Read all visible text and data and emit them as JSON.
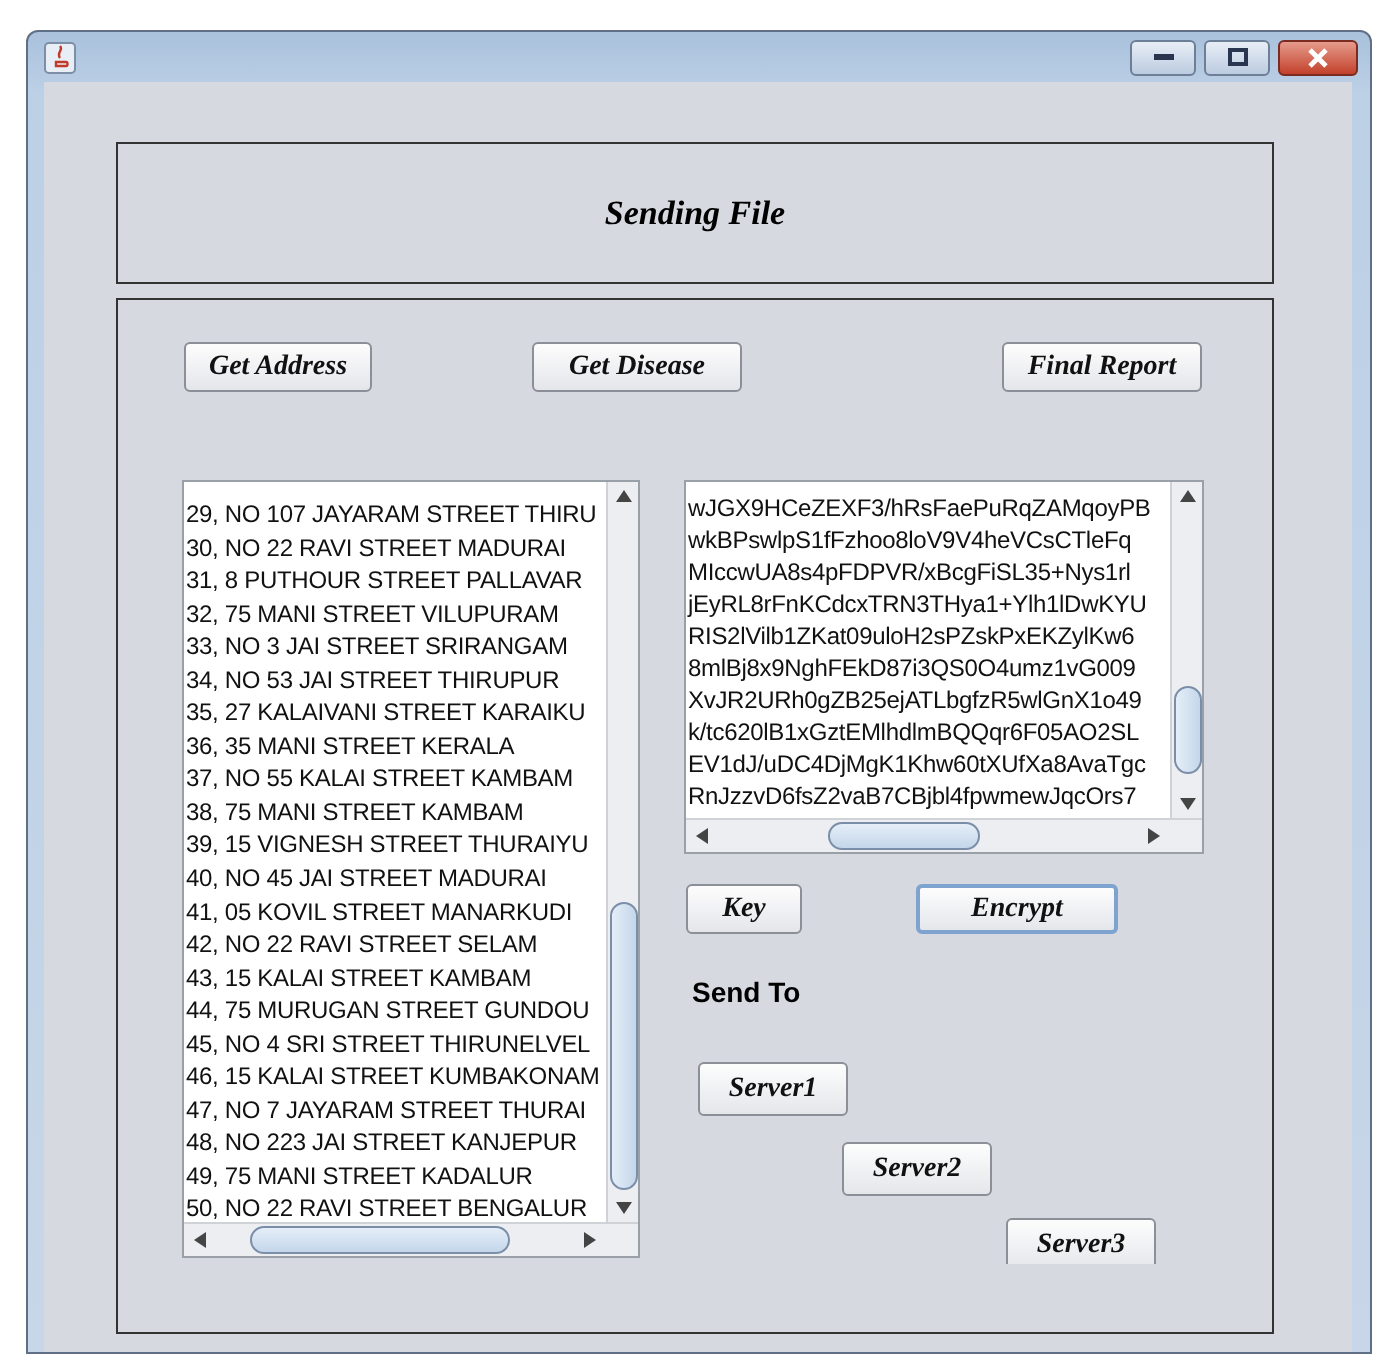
{
  "header": {
    "title": "Sending File"
  },
  "top_buttons": [
    {
      "label": "Get Address"
    },
    {
      "label": "Get Disease"
    },
    {
      "label": "Final Report"
    }
  ],
  "address_list": {
    "rows": [
      "29, NO 107  JAYARAM STREET THIRU",
      "30, NO 22 RAVI STREET MADURAI",
      "31, 8 PUTHOUR STREET PALLAVAR",
      "32, 75 MANI STREET VILUPURAM",
      "33, NO 3  JAI STREET SRIRANGAM",
      "34, NO 53  JAI STREET THIRUPUR",
      "35, 27 KALAIVANI STREET KARAIKU",
      "36, 35 MANI STREET KERALA",
      "37, NO 55  KALAI STREET KAMBAM",
      "38, 75 MANI STREET KAMBAM",
      "39, 15 VIGNESH STREET THURAIYU",
      "40, NO 45 JAI STREET MADURAI",
      "41, 05 KOVIL STREET MANARKUDI",
      "42, NO 22 RAVI STREET SELAM",
      "43, 15 KALAI STREET KAMBAM",
      "44, 75 MURUGAN STREET GUNDOU",
      "45, NO 4 SRI STREET THIRUNELVEL",
      "46, 15 KALAI STREET KUMBAKONAM",
      "47, NO 7  JAYARAM STREET THURAI",
      "48, NO 223  JAI STREET KANJEPUR",
      "49, 75 MANI STREET KADALUR",
      "50, NO 22 RAVI STREET BENGALUR"
    ]
  },
  "encrypted_text": {
    "lines": [
      "wJGX9HCeZEXF3/hRsFaePuRqZAMqoyPB",
      "wkBPswlpS1fFzhoo8loV9V4heVCsCTleFq",
      "MIccwUA8s4pFDPVR/xBcgFiSL35+Nys1rl",
      "jEyRL8rFnKCdcxTRN3THya1+Ylh1lDwKYU",
      "RIS2lVilb1ZKat09uloH2sPZskPxEKZylKw6",
      "8mlBj8x9NghFEkD87i3QS0O4umz1vG009",
      "XvJR2URh0gZB25ejATLbgfzR5wlGnX1o49",
      "k/tc620lB1xGztEMlhdlmBQQqr6F05AO2SL",
      "EV1dJ/uDC4DjMgK1Khw60tXUfXa8AvaTgc",
      "RnJzzvD6fsZ2vaB7CBjbl4fpwmewJqcOrs7"
    ]
  },
  "action_buttons": [
    {
      "label": "Key",
      "focused": false
    },
    {
      "label": "Encrypt",
      "focused": true
    }
  ],
  "send_to": {
    "label": "Send To"
  },
  "servers": [
    {
      "label": "Server1"
    },
    {
      "label": "Server2"
    },
    {
      "label": "Server3"
    }
  ]
}
